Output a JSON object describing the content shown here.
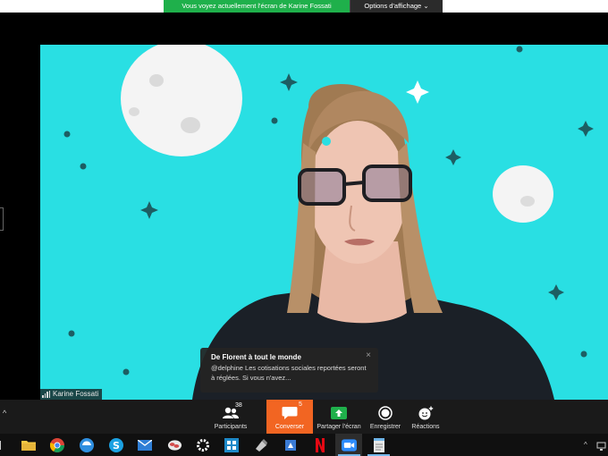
{
  "banner": {
    "sharing_text": "Vous voyez actuellement l'écran de Karine Fossati",
    "view_options_label": "Options d'affichage",
    "view_options_caret": "⌄"
  },
  "video": {
    "participant_name": "Karine Fossati",
    "background_color": "#29dfe3"
  },
  "chat_toast": {
    "from": "De Florent à tout le monde",
    "message": "@delphine Les cotisations sociales reportées seront à réglées. Si vous n'avez...",
    "close_icon": "×"
  },
  "toolbar": {
    "expand_icon": "^",
    "participants": {
      "label": "Participants",
      "count": "38"
    },
    "chat": {
      "label": "Converser",
      "badge": "5",
      "color": "#f26522"
    },
    "share": {
      "label": "Partager l'écran"
    },
    "record": {
      "label": "Enregistrer"
    },
    "reactions": {
      "label": "Réactions"
    }
  },
  "taskbar": {
    "apps": [
      "start",
      "file-explorer",
      "chrome",
      "edge",
      "skype",
      "mail",
      "cloud-app",
      "settings",
      "store",
      "paint",
      "netflix",
      "zoom",
      "notepad"
    ],
    "tray_caret": "^"
  },
  "colors": {
    "banner_green": "#1fb04b",
    "toolbar_bg": "#1a1a1a",
    "accent_orange": "#f26522"
  }
}
